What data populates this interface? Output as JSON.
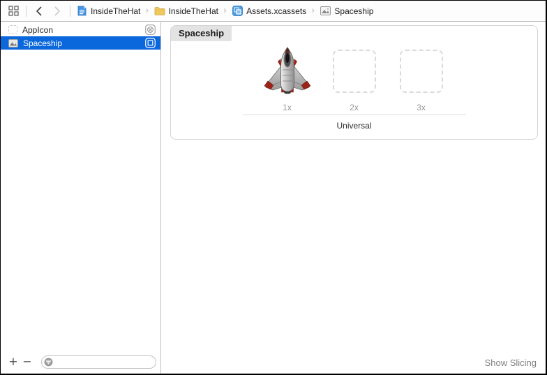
{
  "jumpbar": {
    "separator": "›",
    "breadcrumbs": [
      {
        "label": "InsideTheHat",
        "icon": "project-file-icon"
      },
      {
        "label": "InsideTheHat",
        "icon": "folder-icon"
      },
      {
        "label": "Assets.xcassets",
        "icon": "asset-catalog-icon"
      },
      {
        "label": "Spaceship",
        "icon": "image-icon"
      }
    ]
  },
  "sidebar": {
    "items": [
      {
        "label": "AppIcon",
        "selected": false,
        "badge": "app-icon-badge"
      },
      {
        "label": "Spaceship",
        "selected": true,
        "badge": "image-set-badge"
      }
    ],
    "add_label": "+",
    "remove_label": "−",
    "filter_value": "",
    "filter_placeholder": ""
  },
  "detail": {
    "set_name": "Spaceship",
    "slots": [
      {
        "scale": "1x",
        "filled": true
      },
      {
        "scale": "2x",
        "filled": false
      },
      {
        "scale": "3x",
        "filled": false
      }
    ],
    "idiom": "Universal"
  },
  "footer": {
    "show_slicing_label": "Show Slicing"
  },
  "colors": {
    "selection_blue": "#0a67dc",
    "chip_gray": "#e3e3e3",
    "folder_yellow": "#f0c95c",
    "catalog_blue": "#4a9be0",
    "ship_red": "#9e2317",
    "border_gray": "#d5d5d5"
  }
}
